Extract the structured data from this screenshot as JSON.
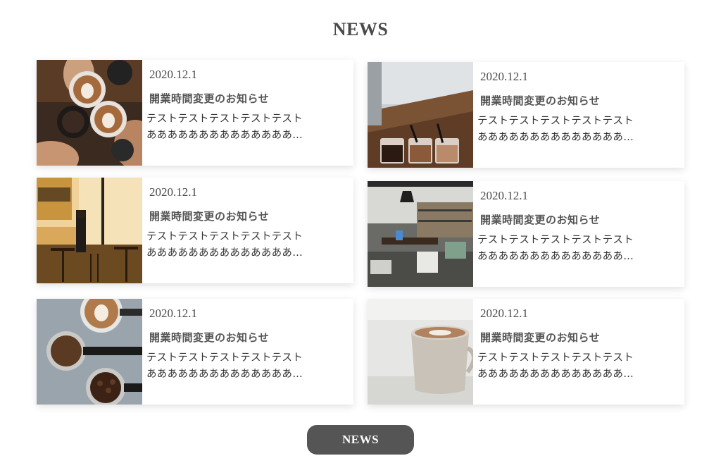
{
  "section": {
    "title": "NEWS"
  },
  "news": [
    {
      "date": "2020.12.1",
      "title": "開業時間変更のお知らせ",
      "line1": "テストテストテストテストテスト",
      "line2": "ああああああああああああああ…",
      "image": "latte-cheers-photo"
    },
    {
      "date": "2020.12.1",
      "title": "開業時間変更のお知らせ",
      "line1": "テストテストテストテストテスト",
      "line2": "ああああああああああああああ…",
      "image": "coffee-glasses-counter-photo"
    },
    {
      "date": "2020.12.1",
      "title": "開業時間変更のお知らせ",
      "line1": "テストテストテストテストテスト",
      "line2": "ああああああああああああああ…",
      "image": "cafe-storefront-photo"
    },
    {
      "date": "2020.12.1",
      "title": "開業時間変更のお知らせ",
      "line1": "テストテストテストテストテスト",
      "line2": "ああああああああああああああ…",
      "image": "cafe-interior-photo"
    },
    {
      "date": "2020.12.1",
      "title": "開業時間変更のお知らせ",
      "line1": "テストテストテストテストテスト",
      "line2": "ああああああああああああああ…",
      "image": "espresso-portafilters-photo"
    },
    {
      "date": "2020.12.1",
      "title": "開業時間変更のお知らせ",
      "line1": "テストテストテストテストテスト",
      "line2": "ああああああああああああああ…",
      "image": "latte-mug-photo"
    }
  ],
  "button": {
    "label": "NEWS"
  }
}
